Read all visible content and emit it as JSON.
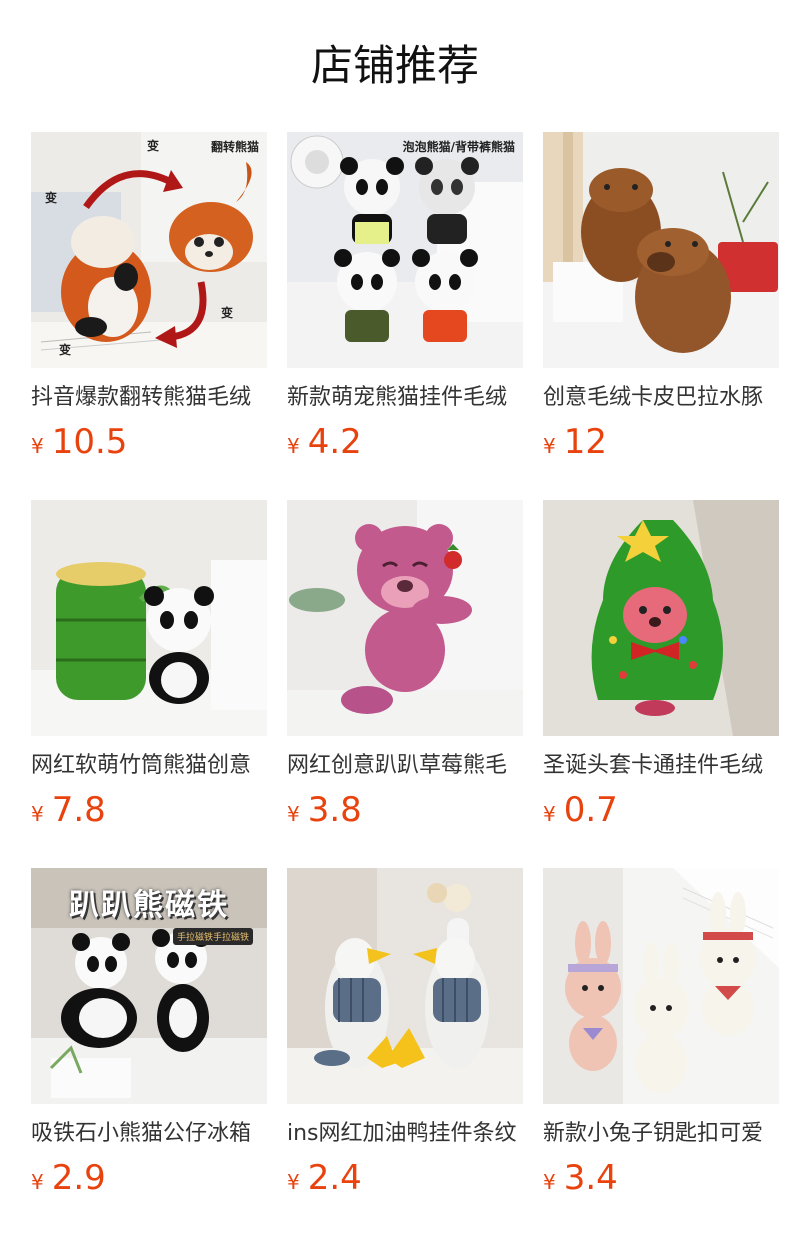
{
  "page": {
    "title": "店铺推荐",
    "currency_symbol": "¥"
  },
  "accent_color": "#e8430f",
  "products": [
    {
      "title": "抖音爆款翻转熊猫毛绒",
      "price": "10.5",
      "image": "red-panda-reversible-plush",
      "image_text": "翻转熊猫",
      "image_marks": [
        "变",
        "变",
        "变",
        "变"
      ]
    },
    {
      "title": "新款萌宠熊猫挂件毛绒",
      "price": "4.2",
      "image": "panda-keychains-plush",
      "image_text": "泡泡熊猫/背带裤熊猫"
    },
    {
      "title": "创意毛绒卡皮巴拉水豚",
      "price": "12",
      "image": "capybara-plush"
    },
    {
      "title": "网红软萌竹筒熊猫创意",
      "price": "7.8",
      "image": "bamboo-tube-panda-plush"
    },
    {
      "title": "网红创意趴趴草莓熊毛",
      "price": "3.8",
      "image": "strawberry-bear-plush"
    },
    {
      "title": "圣诞头套卡通挂件毛绒",
      "price": "0.7",
      "image": "christmas-tree-hood-plush"
    },
    {
      "title": "吸铁石小熊猫公仔冰箱",
      "price": "2.9",
      "image": "magnet-panda-plush",
      "image_text": "趴趴熊磁铁",
      "image_tag": "手拉磁铁手拉磁铁"
    },
    {
      "title": "ins网红加油鸭挂件条纹",
      "price": "2.4",
      "image": "striped-duck-plush"
    },
    {
      "title": "新款小兔子钥匙扣可爱",
      "price": "3.4",
      "image": "bunny-keychain-plush"
    }
  ]
}
